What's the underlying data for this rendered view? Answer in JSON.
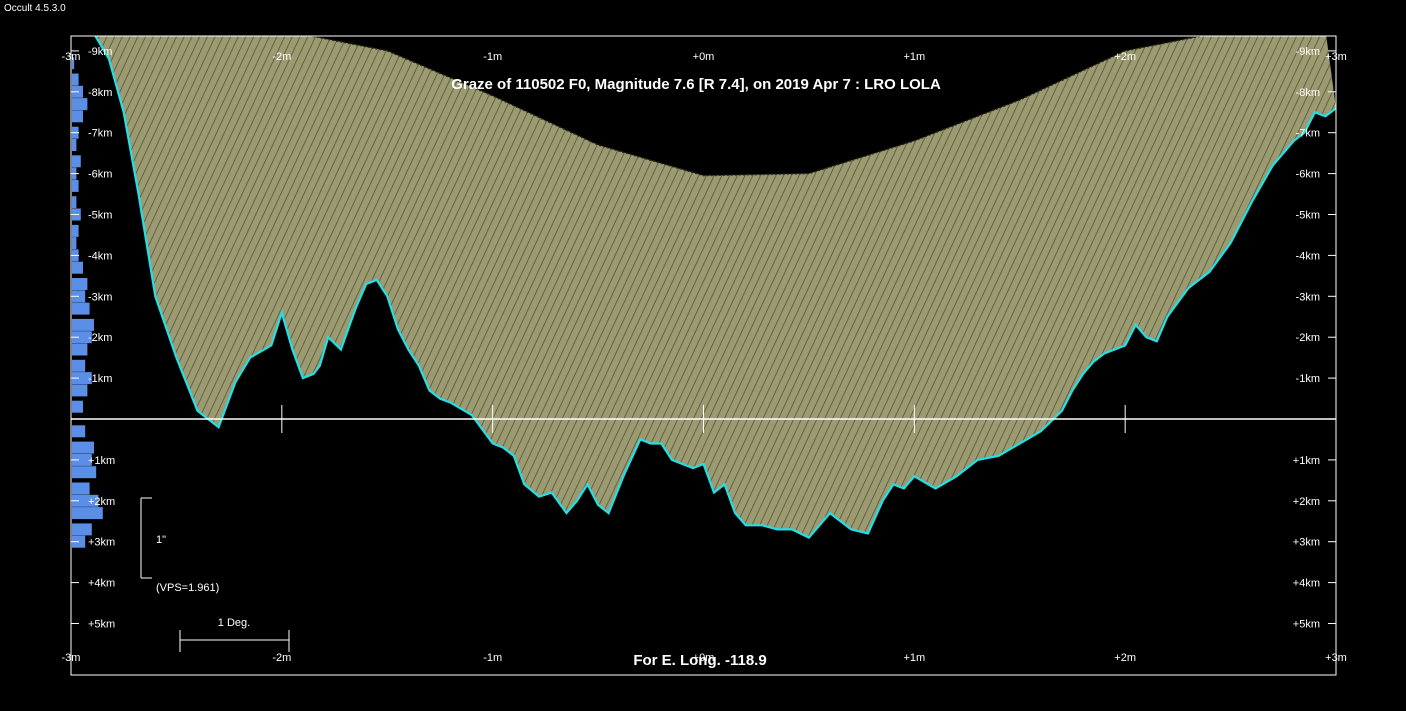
{
  "app": {
    "version": "Occult 4.5.3.0"
  },
  "colors": {
    "background": "#000000",
    "terrain": "#9c9a70",
    "hatch": "#1a1a10",
    "limb": "#20e0e8",
    "histogram": "#5b8ee6",
    "axis": "#ffffff"
  },
  "chart_data": {
    "type": "area",
    "title": "Graze of  110502 F0,  Magnitude 7.6 [R 7.4],  on 2019 Apr  7  :  LRO LOLA",
    "footer": "For E. Long. -118.9",
    "xlabel": "",
    "ylabel": "",
    "xlim": [
      -3,
      3
    ],
    "ylim": [
      -9.5,
      6.3
    ],
    "x_unit_tick_labels": [
      "-3m",
      "-2m",
      "-1m",
      "+0m",
      "+1m",
      "+2m",
      "+3m"
    ],
    "x_tick_values": [
      -3,
      -2,
      -1,
      0,
      1,
      2,
      3
    ],
    "y_tick_labels_left": [
      "-9km",
      "-8km",
      "-7km",
      "-6km",
      "-5km",
      "-4km",
      "-3km",
      "-2km",
      "-1km",
      "+1km",
      "+2km",
      "+3km",
      "+4km",
      "+5km"
    ],
    "y_tick_values_left": [
      -9,
      -8,
      -7,
      -6,
      -5,
      -4,
      -3,
      -2,
      -1,
      1,
      2,
      3,
      4,
      5
    ],
    "y_tick_labels_right": [
      "-9km",
      "-8km",
      "-7km",
      "-6km",
      "-5km",
      "-4km",
      "-3km",
      "-2km",
      "-1km",
      "+1km",
      "+2km",
      "+3km",
      "+4km",
      "+5km"
    ],
    "y_tick_values_right": [
      -9,
      -8,
      -7,
      -6,
      -5,
      -4,
      -3,
      -2,
      -1,
      1,
      2,
      3,
      4,
      5
    ],
    "limb_profile": {
      "name": "",
      "x": [
        -3.0,
        -2.9,
        -2.82,
        -2.75,
        -2.68,
        -2.6,
        -2.5,
        -2.4,
        -2.3,
        -2.22,
        -2.15,
        -2.05,
        -2.0,
        -1.95,
        -1.9,
        -1.85,
        -1.82,
        -1.78,
        -1.72,
        -1.65,
        -1.6,
        -1.55,
        -1.5,
        -1.45,
        -1.4,
        -1.35,
        -1.3,
        -1.25,
        -1.2,
        -1.1,
        -1.0,
        -0.95,
        -0.9,
        -0.85,
        -0.78,
        -0.72,
        -0.65,
        -0.6,
        -0.55,
        -0.5,
        -0.45,
        -0.38,
        -0.3,
        -0.25,
        -0.2,
        -0.15,
        -0.1,
        -0.05,
        0.0,
        0.05,
        0.1,
        0.15,
        0.2,
        0.28,
        0.35,
        0.42,
        0.5,
        0.55,
        0.6,
        0.65,
        0.7,
        0.78,
        0.85,
        0.9,
        0.95,
        1.0,
        1.1,
        1.2,
        1.3,
        1.4,
        1.5,
        1.6,
        1.7,
        1.75,
        1.8,
        1.85,
        1.9,
        2.0,
        2.05,
        2.1,
        2.15,
        2.2,
        2.3,
        2.4,
        2.5,
        2.6,
        2.7,
        2.8,
        2.85,
        2.9,
        2.95,
        3.0
      ],
      "y": [
        -9.4,
        -9.5,
        -8.8,
        -7.5,
        -5.5,
        -3.0,
        -1.5,
        -0.2,
        0.2,
        -0.9,
        -1.5,
        -1.8,
        -2.6,
        -1.7,
        -1.0,
        -1.1,
        -1.3,
        -2.0,
        -1.7,
        -2.7,
        -3.3,
        -3.4,
        -3.0,
        -2.2,
        -1.7,
        -1.3,
        -0.7,
        -0.5,
        -0.4,
        -0.1,
        0.6,
        0.7,
        0.9,
        1.6,
        1.9,
        1.8,
        2.3,
        2.0,
        1.6,
        2.1,
        2.3,
        1.4,
        0.5,
        0.6,
        0.6,
        1.0,
        1.1,
        1.2,
        1.1,
        1.8,
        1.6,
        2.3,
        2.6,
        2.6,
        2.7,
        2.7,
        2.9,
        2.6,
        2.3,
        2.5,
        2.7,
        2.8,
        2.0,
        1.6,
        1.7,
        1.4,
        1.7,
        1.4,
        1.0,
        0.9,
        0.6,
        0.3,
        -0.2,
        -0.7,
        -1.1,
        -1.4,
        -1.6,
        -1.8,
        -2.3,
        -2.0,
        -1.9,
        -2.5,
        -3.2,
        -3.6,
        -4.3,
        -5.3,
        -6.2,
        -6.8,
        -7.0,
        -7.5,
        -7.4,
        -7.6
      ]
    },
    "upper_boundary": {
      "name": "",
      "x": [
        -2.8,
        -2.5,
        -2.0,
        -1.5,
        -1.0,
        -0.5,
        0.0,
        0.5,
        1.0,
        1.5,
        2.0,
        2.5,
        2.95
      ],
      "y": [
        -9.5,
        -9.5,
        -9.5,
        -9.0,
        -7.9,
        -6.7,
        -5.95,
        -6.0,
        -6.8,
        -7.8,
        -9.0,
        -9.5,
        -9.5
      ]
    },
    "histogram_left": {
      "name": "",
      "y": [
        -8.7,
        -8.3,
        -8.0,
        -7.7,
        -7.4,
        -7.0,
        -6.7,
        -6.3,
        -6.0,
        -5.7,
        -5.3,
        -5.0,
        -4.6,
        -4.3,
        -4.0,
        -3.7,
        -3.3,
        -3.0,
        -2.7,
        -2.3,
        -2.0,
        -1.7,
        -1.3,
        -1.0,
        -0.7,
        -0.3,
        0.3,
        0.7,
        1.0,
        1.3,
        1.7,
        2.0,
        2.3,
        2.7,
        3.0
      ],
      "values": [
        1,
        3,
        5,
        7,
        5,
        3,
        2,
        4,
        2,
        3,
        2,
        4,
        3,
        2,
        3,
        5,
        7,
        6,
        8,
        10,
        9,
        7,
        6,
        9,
        7,
        5,
        6,
        10,
        9,
        11,
        8,
        12,
        14,
        9,
        6
      ]
    },
    "scale_bar": {
      "label": "1\"",
      "vps_label": "(VPS=1.961)"
    },
    "degree_bar": {
      "label": "1 Deg."
    },
    "grid": false,
    "legend": "none"
  }
}
